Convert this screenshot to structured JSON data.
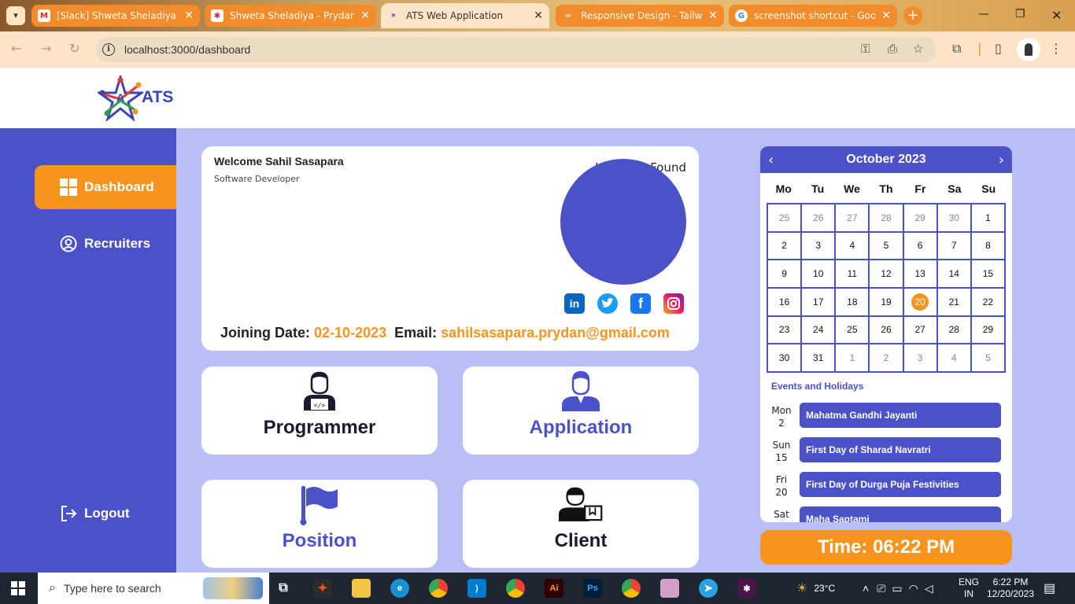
{
  "browser": {
    "tabs": [
      {
        "label": "[Slack] Shweta Sheladiya sen",
        "favicon": "gmail-icon",
        "active": false
      },
      {
        "label": "Shweta Sheladiya - Prydan -",
        "favicon": "slack-icon",
        "active": false
      },
      {
        "label": "ATS Web Application",
        "favicon": "ats-icon",
        "active": true
      },
      {
        "label": "Responsive Design - Tailwin",
        "favicon": "tailwind-icon",
        "active": false
      },
      {
        "label": "screenshot shortcut - Googl",
        "favicon": "google-icon",
        "active": false
      }
    ],
    "url": "localhost:3000/dashboard"
  },
  "app": {
    "logo_text": "ATS"
  },
  "sidebar": {
    "items": [
      {
        "label": "Dashboard",
        "icon": "grid-icon",
        "active": true
      },
      {
        "label": "Recruiters",
        "icon": "user-circle-icon",
        "active": false
      }
    ],
    "logout_label": "Logout"
  },
  "welcome": {
    "title": "Welcome Sahil Sasapara",
    "role": "Software Developer",
    "avatar_alt": "User Not Found",
    "joining_label": "Joining Date:",
    "joining_date": "02-10-2023",
    "email_label": "Email:",
    "email": "sahilsasapara.prydan@gmail.com",
    "socials": [
      "linkedin-icon",
      "twitter-icon",
      "facebook-icon",
      "instagram-icon"
    ]
  },
  "cards": [
    {
      "label": "Programmer",
      "icon": "programmer-icon",
      "color": "#1b1b2f"
    },
    {
      "label": "Application",
      "icon": "client-person-icon",
      "color": "#4b51c7"
    },
    {
      "label": "Position",
      "icon": "flag-icon",
      "color": "#4b51c7"
    },
    {
      "label": "Client",
      "icon": "client-box-icon",
      "color": "#1b1b2f"
    }
  ],
  "calendar": {
    "month_label": "October 2023",
    "weekdays": [
      "Mo",
      "Tu",
      "We",
      "Th",
      "Fr",
      "Sa",
      "Su"
    ],
    "days": [
      {
        "d": "25",
        "m": true
      },
      {
        "d": "26",
        "m": true
      },
      {
        "d": "27",
        "m": true
      },
      {
        "d": "28",
        "m": true
      },
      {
        "d": "29",
        "m": true
      },
      {
        "d": "30",
        "m": true
      },
      {
        "d": "1"
      },
      {
        "d": "2"
      },
      {
        "d": "3"
      },
      {
        "d": "4"
      },
      {
        "d": "5"
      },
      {
        "d": "6"
      },
      {
        "d": "7"
      },
      {
        "d": "8"
      },
      {
        "d": "9"
      },
      {
        "d": "10"
      },
      {
        "d": "11"
      },
      {
        "d": "12"
      },
      {
        "d": "13"
      },
      {
        "d": "14"
      },
      {
        "d": "15"
      },
      {
        "d": "16"
      },
      {
        "d": "17"
      },
      {
        "d": "18"
      },
      {
        "d": "19"
      },
      {
        "d": "20",
        "today": true
      },
      {
        "d": "21"
      },
      {
        "d": "22"
      },
      {
        "d": "23"
      },
      {
        "d": "24"
      },
      {
        "d": "25"
      },
      {
        "d": "26"
      },
      {
        "d": "27"
      },
      {
        "d": "28"
      },
      {
        "d": "29"
      },
      {
        "d": "30"
      },
      {
        "d": "31"
      },
      {
        "d": "1",
        "m": true
      },
      {
        "d": "2",
        "m": true
      },
      {
        "d": "3",
        "m": true
      },
      {
        "d": "4",
        "m": true
      },
      {
        "d": "5",
        "m": true
      }
    ],
    "events_title": "Events and Holidays",
    "events": [
      {
        "day": "Mon",
        "date": "2",
        "name": "Mahatma Gandhi Jayanti"
      },
      {
        "day": "Sun",
        "date": "15",
        "name": "First Day of Sharad Navratri"
      },
      {
        "day": "Fri",
        "date": "20",
        "name": "First Day of Durga Puja Festivities"
      },
      {
        "day": "Sat",
        "date": "",
        "name": "Maha Saptami"
      }
    ]
  },
  "clock": {
    "text": "Time: 06:22 PM"
  },
  "taskbar": {
    "search_placeholder": "Type here to search",
    "weather": "23°C",
    "lang_1": "ENG",
    "lang_2": "IN",
    "time": "6:22 PM",
    "date": "12/20/2023"
  },
  "colors": {
    "primary": "#4b51c7",
    "accent": "#f7941d",
    "background": "#b9bef7"
  }
}
